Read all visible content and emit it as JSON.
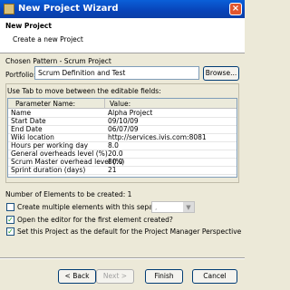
{
  "window": {
    "title": "New Project Wizard",
    "close_glyph": "×"
  },
  "header": {
    "title": "New Project",
    "description": "Create a new Project"
  },
  "pattern": {
    "label": "Chosen Pattern - Scrum Project",
    "portfolio_label": "Portfolio:",
    "portfolio_value": "Scrum Definition and Test",
    "browse_label": "Browse..."
  },
  "fields": {
    "instruction": "Use Tab to move between the editable fields:",
    "columns": [
      "Parameter Name:",
      "Value:"
    ],
    "rows": [
      {
        "name": "Name",
        "value": "Alpha Project"
      },
      {
        "name": "Start Date",
        "value": "09/10/09"
      },
      {
        "name": "End Date",
        "value": "06/07/09"
      },
      {
        "name": "Wiki location",
        "value": "http://services.ivis.com:8081"
      },
      {
        "name": "Hours per working day",
        "value": "8.0"
      },
      {
        "name": "General overheads level (%)",
        "value": "20.0"
      },
      {
        "name": "Scrum Master overhead level (%)",
        "value": "80.0"
      },
      {
        "name": "Sprint duration (days)",
        "value": "21"
      }
    ]
  },
  "elements_count_text": "Number of Elements to be created: 1",
  "options": {
    "multiple_label": "Create multiple elements with this separator:",
    "multiple_checked": false,
    "separator_value": ",",
    "open_editor_label": "Open the editor for the first element created?",
    "open_editor_checked": true,
    "default_label": "Set this Project as the default for the Project Manager Perspective",
    "default_checked": true
  },
  "buttons": {
    "back": "< Back",
    "next": "Next >",
    "finish": "Finish",
    "cancel": "Cancel"
  }
}
